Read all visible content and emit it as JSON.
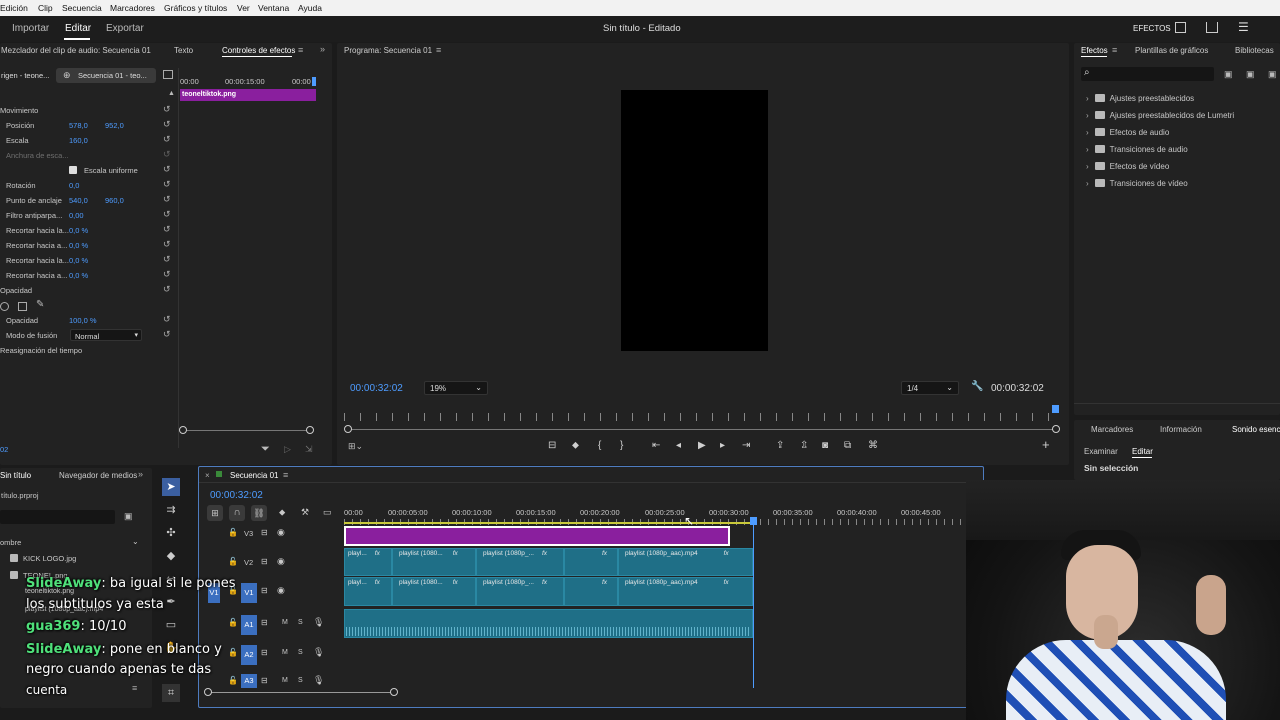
{
  "menu": [
    "Edición",
    "Clip",
    "Secuencia",
    "Marcadores",
    "Gráficos y títulos",
    "Ver",
    "Ventana",
    "Ayuda"
  ],
  "header": {
    "tabs": [
      "Importar",
      "Editar",
      "Exportar"
    ],
    "title": "Sin título - Editado",
    "effects_label": "EFECTOS"
  },
  "left_panel": {
    "tabs": [
      "Mezclador del clip de audio: Secuencia 01",
      "Texto",
      "Controles de efectos"
    ],
    "source_tabs": [
      "rigen - teone...",
      "Secuencia 01 - teo..."
    ],
    "ruler": [
      "00:00",
      "00:00:15:00",
      "00:00"
    ],
    "clip_name": "teoneltiktok.png",
    "section_motion": "Movimiento",
    "rows": [
      {
        "label": "Posición",
        "v1": "578,0",
        "v2": "952,0"
      },
      {
        "label": "Escala",
        "v1": "160,0",
        "v2": ""
      },
      {
        "label": "Anchura de esca...",
        "v1": "",
        "v2": ""
      },
      {
        "label": "Escala uniforme",
        "v1": "",
        "v2": ""
      },
      {
        "label": "Rotación",
        "v1": "0,0",
        "v2": ""
      },
      {
        "label": "Punto de anclaje",
        "v1": "540,0",
        "v2": "960,0"
      },
      {
        "label": "Filtro antiparpa...",
        "v1": "0,00",
        "v2": ""
      },
      {
        "label": "Recortar hacia la...",
        "v1": "0,0 %",
        "v2": ""
      },
      {
        "label": "Recortar hacia a...",
        "v1": "0,0 %",
        "v2": ""
      },
      {
        "label": "Recortar hacia la...",
        "v1": "0,0 %",
        "v2": ""
      },
      {
        "label": "Recortar hacia a...",
        "v1": "0,0 %",
        "v2": ""
      }
    ],
    "section_opacity": "Opacidad",
    "opacity_label": "Opacidad",
    "opacity_value": "100,0 %",
    "blend_label": "Modo de fusión",
    "blend_value": "Normal",
    "time_remap": "Reasignación del tiempo",
    "bottom_tc": "02"
  },
  "program": {
    "title": "Programa: Secuencia 01",
    "timecode_left": "00:00:32:02",
    "zoom": "19%",
    "quality": "1/4",
    "timecode_right": "00:00:32:02"
  },
  "effects_panel": {
    "tabs": [
      "Efectos",
      "Plantillas de gráficos",
      "Bibliotecas"
    ],
    "items": [
      "Ajustes preestablecidos",
      "Ajustes preestablecidos de Lumetri",
      "Efectos de audio",
      "Transiciones de audio",
      "Efectos de vídeo",
      "Transiciones de vídeo"
    ]
  },
  "right_bottom": {
    "tabs": [
      "Marcadores",
      "Información",
      "Sonido esencia"
    ],
    "subtabs": [
      "Examinar",
      "Editar"
    ],
    "status": "Sin selección"
  },
  "project": {
    "tabs": [
      "Sin título",
      "Navegador de medios"
    ],
    "file": "título.prproj",
    "column": "ombre",
    "items": [
      "KICK LOGO.jpg",
      "TEONEL.png",
      "teoneltiktok.png",
      "playlist (1080p_aac).mp4"
    ]
  },
  "timeline": {
    "title": "Secuencia 01",
    "timecode": "00:00:32:02",
    "ruler": [
      "00:00",
      "00:00:05:00",
      "00:00:10:00",
      "00:00:15:00",
      "00:00:20:00",
      "00:00:25:00",
      "00:00:30:00",
      "00:00:35:00",
      "00:00:40:00",
      "00:00:45:00"
    ],
    "tracks": [
      "V3",
      "V2",
      "V1",
      "A1",
      "A2",
      "A3"
    ],
    "source_v": "V1",
    "source_a": "A1",
    "clip_short": "playl...",
    "clip_mid": "playlist (1080...",
    "clip_mid2": "playlist (1080p_...",
    "clip_long": "playlist (1080p_aac).mp4"
  },
  "chat": [
    {
      "name": "SlideAway",
      "text": ": ba igual si le pones"
    },
    {
      "name": "",
      "text": "los subtitulos ya esta"
    },
    {
      "name": "gua369",
      "text": ": 10/10"
    },
    {
      "name": "SlideAway",
      "text": ": pone en blanco y"
    },
    {
      "name": "",
      "text": "negro cuando apenas te das"
    },
    {
      "name": "",
      "text": "cuenta"
    }
  ]
}
